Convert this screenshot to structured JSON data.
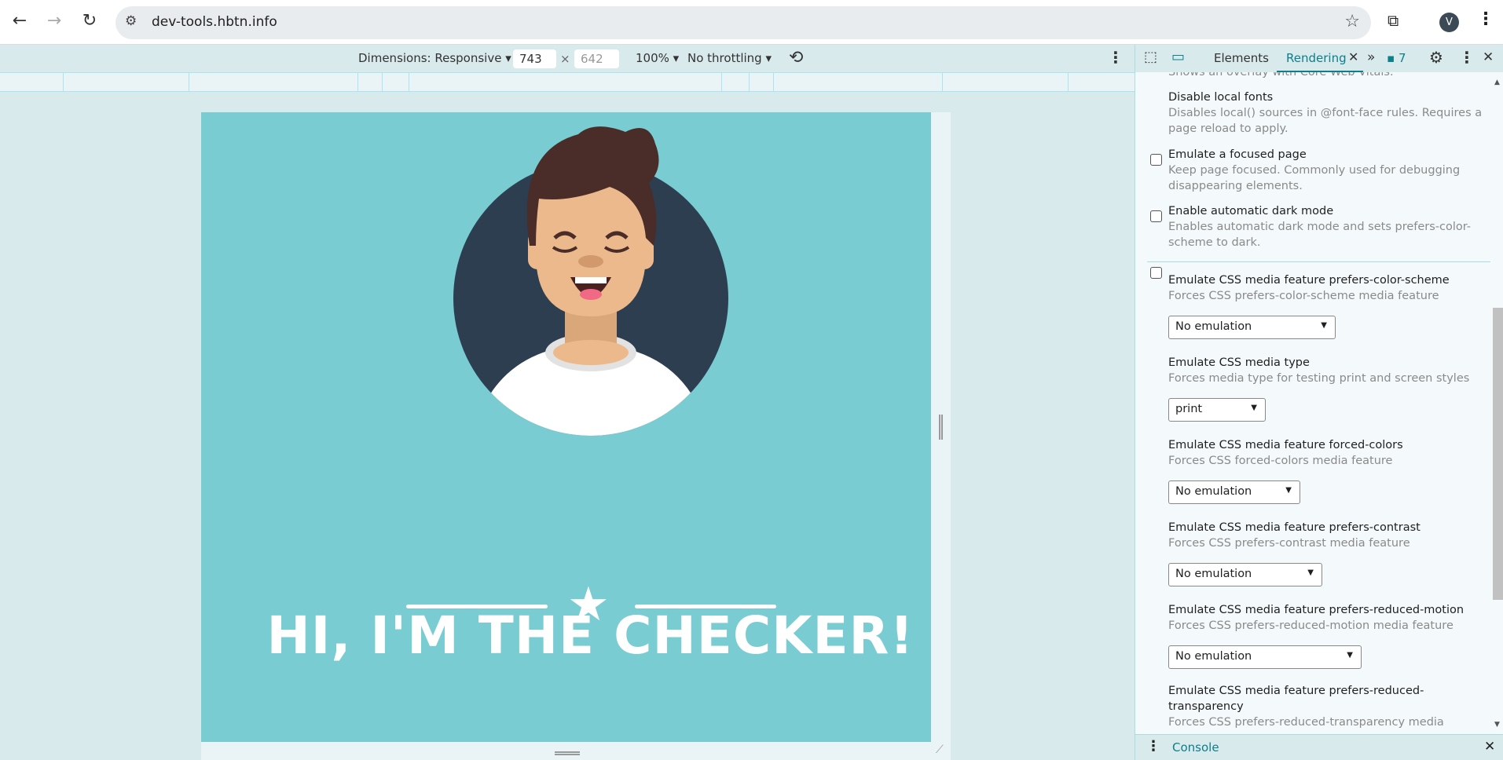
{
  "browser": {
    "url": "dev-tools.hbtn.info",
    "profile_initial": "V"
  },
  "device_toolbar": {
    "dimensions": "Dimensions: Responsive",
    "width": "743",
    "times": "×",
    "height": "642",
    "zoom": "100%",
    "throttling": "No throttling"
  },
  "page": {
    "heading": "HI, I'M THE CHECKER!",
    "colors": {
      "background": "#79ccd2",
      "circle": "#2d3e50",
      "hair": "#4a2c28",
      "skin": "#ebb98b"
    }
  },
  "devtools": {
    "tabs": [
      {
        "label": "Elements"
      },
      {
        "label": "Rendering",
        "active": true
      }
    ],
    "message_count": "7",
    "clipped_text": "Shows an overlay with Core Web Vitals.",
    "checkbox_options": [
      {
        "title": "Disable local fonts",
        "desc": "Disables local() sources in @font-face rules. Requires a page reload to apply.",
        "checked": false
      },
      {
        "title": "Emulate a focused page",
        "desc": "Keep page focused. Commonly used for debugging disappearing elements.",
        "checked": false
      },
      {
        "title": "Enable automatic dark mode",
        "desc": "Enables automatic dark mode and sets prefers-color-scheme to dark.",
        "checked": false
      }
    ],
    "select_options": [
      {
        "title": "Emulate CSS media feature prefers-color-scheme",
        "desc": "Forces CSS prefers-color-scheme media feature",
        "value": "No emulation"
      },
      {
        "title": "Emulate CSS media type",
        "desc": "Forces media type for testing print and screen styles",
        "value": "print"
      },
      {
        "title": "Emulate CSS media feature forced-colors",
        "desc": "Forces CSS forced-colors media feature",
        "value": "No emulation"
      },
      {
        "title": "Emulate CSS media feature prefers-contrast",
        "desc": "Forces CSS prefers-contrast media feature",
        "value": "No emulation"
      },
      {
        "title": "Emulate CSS media feature prefers-reduced-motion",
        "desc": "Forces CSS prefers-reduced-motion media feature",
        "value": "No emulation"
      },
      {
        "title": "Emulate CSS media feature prefers-reduced-transparency",
        "desc": "Forces CSS prefers-reduced-transparency media",
        "value": ""
      }
    ],
    "drawer": {
      "tab": "Console"
    }
  }
}
